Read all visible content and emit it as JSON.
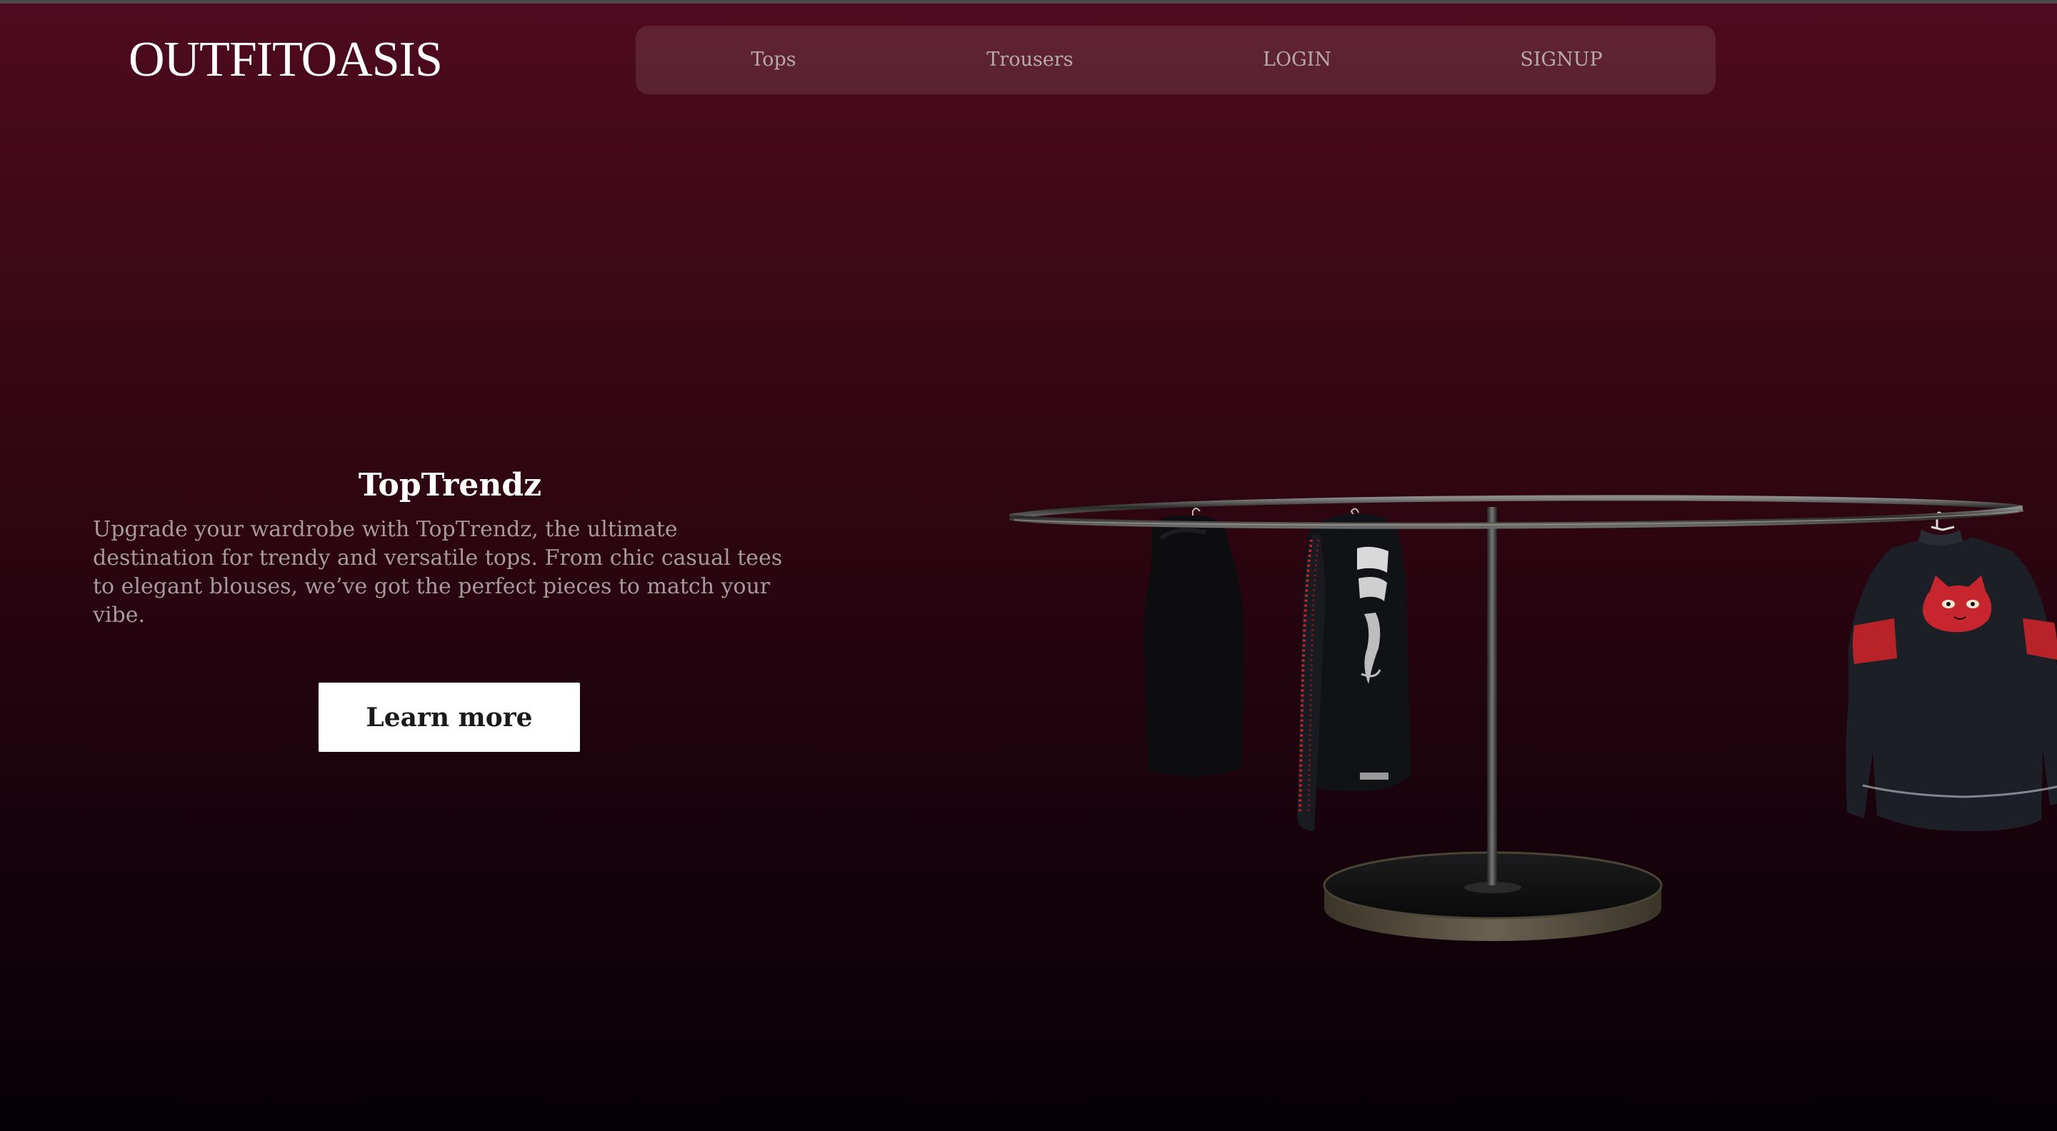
{
  "header": {
    "logo": "OUTFITOASIS"
  },
  "nav": {
    "items": [
      {
        "label": "Tops"
      },
      {
        "label": "Trousers"
      },
      {
        "label": "LOGIN"
      },
      {
        "label": "SIGNUP"
      }
    ]
  },
  "hero": {
    "title": "TopTrendz",
    "description": "Upgrade your wardrobe with TopTrendz, the ultimate destination for trendy and versatile tops. From chic casual tees to elegant blouses, we’ve got the perfect pieces to match your vibe.",
    "cta_label": "Learn more"
  },
  "colors": {
    "background_top": "#4f0a20",
    "background_bottom": "#050104",
    "nav_text": "#b8a9ae",
    "button_bg": "#ffffff",
    "accent_red": "#c8262e"
  }
}
